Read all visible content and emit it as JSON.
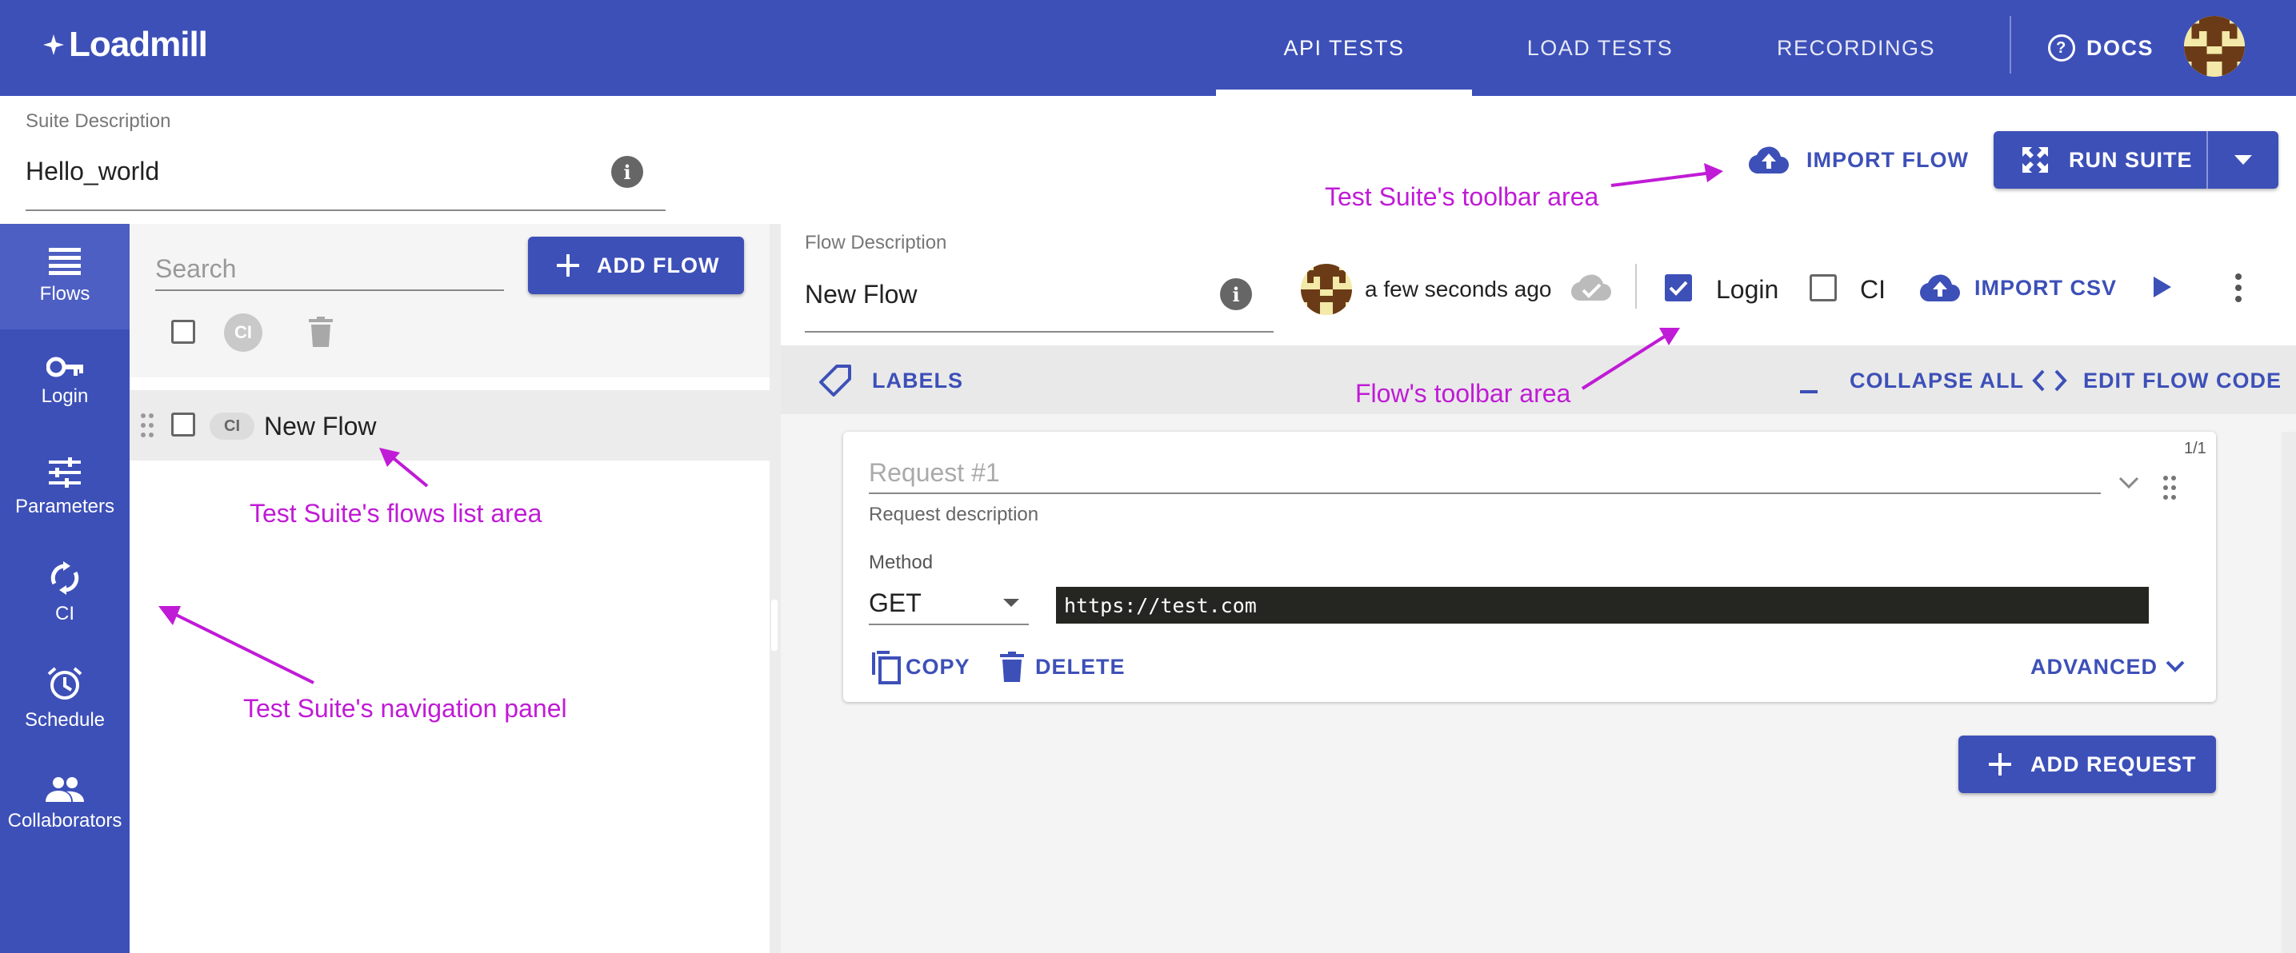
{
  "header": {
    "logo_text": "Loadmill",
    "tabs": [
      {
        "label": "API TESTS",
        "active": true
      },
      {
        "label": "LOAD TESTS",
        "active": false
      },
      {
        "label": "RECORDINGS",
        "active": false
      }
    ],
    "docs_label": "DOCS"
  },
  "suite": {
    "description_label": "Suite Description",
    "description_value": "Hello_world",
    "import_flow_label": "IMPORT FLOW",
    "run_suite_label": "RUN SUITE"
  },
  "sidebar": {
    "items": [
      {
        "label": "Flows",
        "icon": "list-icon",
        "active": true
      },
      {
        "label": "Login",
        "icon": "key-icon",
        "active": false
      },
      {
        "label": "Parameters",
        "icon": "sliders-icon",
        "active": false
      },
      {
        "label": "CI",
        "icon": "sync-icon",
        "active": false
      },
      {
        "label": "Schedule",
        "icon": "alarm-icon",
        "active": false
      },
      {
        "label": "Collaborators",
        "icon": "people-icon",
        "active": false
      }
    ]
  },
  "flows_list": {
    "search_placeholder": "Search",
    "add_flow_label": "ADD FLOW",
    "ci_badge": "CI",
    "flows": [
      {
        "name": "New Flow",
        "ci_label": "CI",
        "selected": true
      }
    ]
  },
  "flow": {
    "description_label": "Flow Description",
    "description_value": "New Flow",
    "last_saved": "a few seconds ago",
    "login_label": "Login",
    "login_checked": true,
    "ci_label": "CI",
    "ci_checked": false,
    "import_csv_label": "IMPORT CSV",
    "labels_label": "LABELS",
    "collapse_all_label": "COLLAPSE ALL",
    "edit_flow_code_label": "EDIT FLOW CODE"
  },
  "request": {
    "count": "1/1",
    "name_placeholder": "Request #1",
    "description_placeholder": "Request description",
    "method_label": "Method",
    "method_value": "GET",
    "url": "https://test.com",
    "copy_label": "COPY",
    "delete_label": "DELETE",
    "advanced_label": "ADVANCED",
    "add_request_label": "ADD REQUEST"
  },
  "annotations": {
    "suite_toolbar": "Test Suite's toolbar area",
    "flow_toolbar": "Flow's toolbar area",
    "flows_list": "Test Suite's flows list area",
    "navigation": "Test Suite's navigation panel"
  },
  "colors": {
    "primary": "#3d50b8",
    "annotation": "#c01bd6"
  }
}
